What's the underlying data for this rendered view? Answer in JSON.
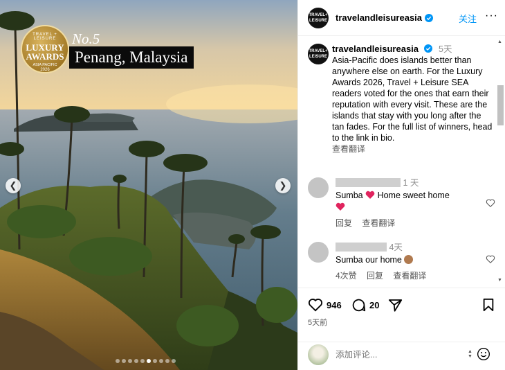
{
  "post": {
    "badge": {
      "top": "TRAVEL + LEISURE",
      "main": "LUXURY AWARDS",
      "sub": "ASIA PACIFIC",
      "year": "2026"
    },
    "rank_label": "No.5",
    "place_label": "Penang, Malaysia",
    "carousel": {
      "total": 10,
      "active": 6
    }
  },
  "header": {
    "avatar_text": "TRAVEL+ LEISURE",
    "username": "travelandleisureasia",
    "follow_label": "关注",
    "more_label": "···"
  },
  "caption": {
    "username": "travelandleisureasia",
    "time": "5天",
    "text": "Asia-Pacific does islands better than anywhere else on earth. For the Luxury Awards 2026, Travel + Leisure SEA readers voted for the ones that earn their reputation with every visit. These are the islands that stay with you long after the tan fades. For the full list of winners, head to the link in bio.",
    "translate_label": "查看翻译"
  },
  "comments": [
    {
      "time": "1 天",
      "text": "Sumba ❤️ Home sweet home",
      "trailing_emoji": "❤️",
      "likes_label": "",
      "actions": [
        "回复",
        "查看翻译"
      ]
    },
    {
      "time": "4天",
      "text": "Sumba our home 🙏",
      "likes_label": "4次赞",
      "actions": [
        "回复",
        "查看翻译"
      ]
    }
  ],
  "comment1": {
    "text_a": "Sumba",
    "text_b": "Home sweet home"
  },
  "comment2": {
    "text": "Sumba our home"
  },
  "stats": {
    "likes": "946",
    "comments": "20",
    "date": "5天前"
  },
  "add_comment": {
    "placeholder": "添加评论..."
  },
  "colors": {
    "link": "#0095f6",
    "verified": "#0095f6",
    "heart": "#e0245e"
  }
}
